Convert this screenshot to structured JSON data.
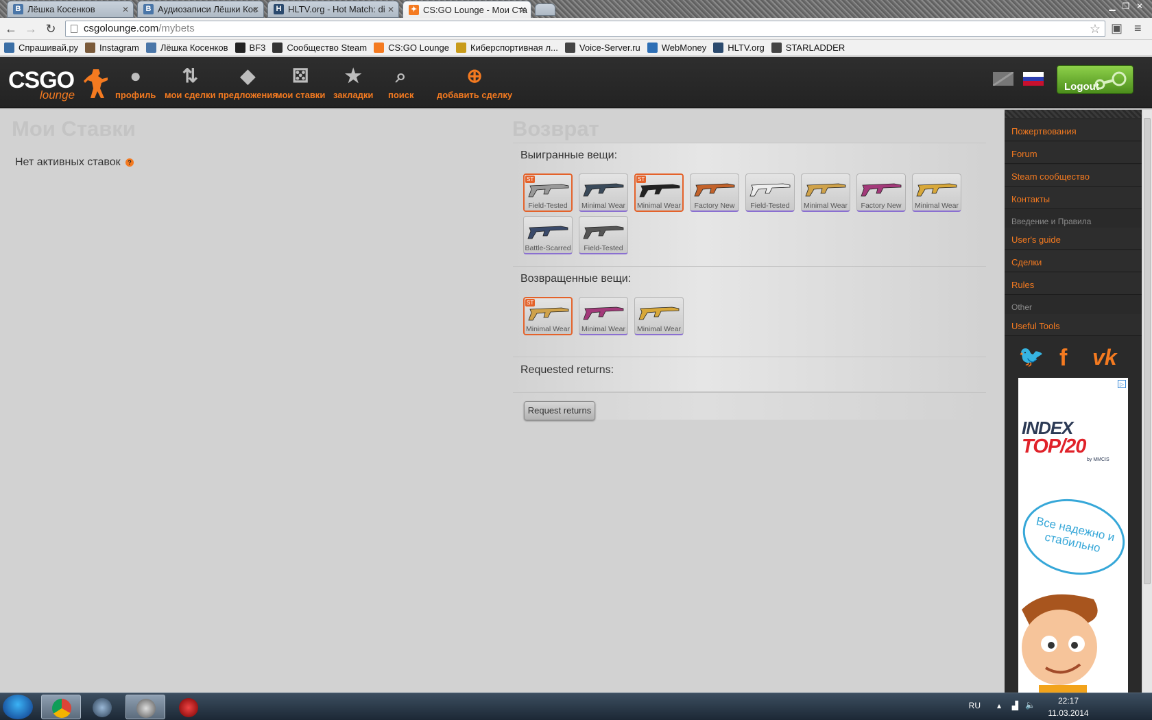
{
  "browser": {
    "tabs": [
      {
        "title": "Лёшка Косенков",
        "icon": "vk-icon",
        "active": false
      },
      {
        "title": "Аудиозаписи Лёшки Кос",
        "icon": "vk-icon",
        "active": false
      },
      {
        "title": "HLTV.org - Hot Match: di",
        "icon": "hltv-icon",
        "active": false
      },
      {
        "title": "CS:GO Lounge - Мои Ста",
        "icon": "csgolounge-icon",
        "active": true
      }
    ],
    "url_domain": "csgolounge.com",
    "url_path": "/mybets",
    "bookmarks": [
      {
        "label": "Спрашивай.ру",
        "color": "#3a6ea5"
      },
      {
        "label": "Instagram",
        "color": "#7a5a3a"
      },
      {
        "label": "Лёшка Косенков",
        "color": "#4a76a8"
      },
      {
        "label": "BF3",
        "color": "#222222"
      },
      {
        "label": "Сообщество Steam",
        "color": "#333333"
      },
      {
        "label": "CS:GO Lounge",
        "color": "#f47a20"
      },
      {
        "label": "Киберспортивная л...",
        "color": "#c89b1a"
      },
      {
        "label": "Voice-Server.ru",
        "color": "#444444"
      },
      {
        "label": "WebMoney",
        "color": "#2e6fb5"
      },
      {
        "label": "HLTV.org",
        "color": "#2b4a6e"
      },
      {
        "label": "STARLADDER",
        "color": "#444444"
      }
    ]
  },
  "site": {
    "logo_main": "CSGO",
    "logo_sub": "lounge",
    "nav": [
      {
        "label": "профиль",
        "icon": "profile-icon"
      },
      {
        "label": "мои сделки",
        "icon": "trades-icon"
      },
      {
        "label": "предложения",
        "icon": "tag-icon"
      },
      {
        "label": "мои ставки",
        "icon": "dice-icon"
      },
      {
        "label": "закладки",
        "icon": "star-icon"
      },
      {
        "label": "поиск",
        "icon": "search-icon"
      },
      {
        "label": "добавить сделку",
        "icon": "add-icon"
      }
    ],
    "logout_label": "Logout",
    "accent_color": "#f47a20"
  },
  "main": {
    "bets_title": "Мои Ставки",
    "no_active_bets": "Нет активных ставок",
    "help_mark": "?",
    "returns_title": "Возврат",
    "won_title": "Выигранные вещи:",
    "won_items": [
      {
        "wear": "Field-Tested",
        "stattrak": true,
        "st_label": "ST"
      },
      {
        "wear": "Minimal Wear",
        "stattrak": false
      },
      {
        "wear": "Minimal Wear",
        "stattrak": true,
        "st_label": "ST"
      },
      {
        "wear": "Factory New",
        "stattrak": false
      },
      {
        "wear": "Field-Tested",
        "stattrak": false
      },
      {
        "wear": "Minimal Wear",
        "stattrak": false
      },
      {
        "wear": "Factory New",
        "stattrak": false
      },
      {
        "wear": "Minimal Wear",
        "stattrak": false
      },
      {
        "wear": "Battle-Scarred",
        "stattrak": false
      },
      {
        "wear": "Field-Tested",
        "stattrak": false
      }
    ],
    "returned_title": "Возвращенные вещи:",
    "returned_items": [
      {
        "wear": "Minimal Wear",
        "stattrak": true,
        "st_label": "ST"
      },
      {
        "wear": "Minimal Wear",
        "stattrak": false
      },
      {
        "wear": "Minimal Wear",
        "stattrak": false
      }
    ],
    "requested_title": "Requested returns:",
    "request_button": "Request returns"
  },
  "sidebar": {
    "links_top": [
      "Пожертвования",
      "Forum",
      "Steam сообщество",
      "Контакты"
    ],
    "head_rules": "Введение и Правила",
    "links_rules": [
      "User's guide",
      "Сделки",
      "Rules"
    ],
    "head_other": "Other",
    "links_other": [
      "Useful Tools"
    ],
    "social": [
      "twitter-icon",
      "facebook-icon",
      "vk-icon"
    ],
    "social_glyphs": [
      "🐦",
      "f",
      "vk"
    ],
    "ad": {
      "index": "INDEX",
      "top20": "TOP/20",
      "brand": "by MMCIS",
      "bubble": "Все надежно и стабильно",
      "adchoice": "▷"
    }
  },
  "taskbar": {
    "lang": "RU",
    "time": "22:17",
    "date": "11.03.2014"
  }
}
